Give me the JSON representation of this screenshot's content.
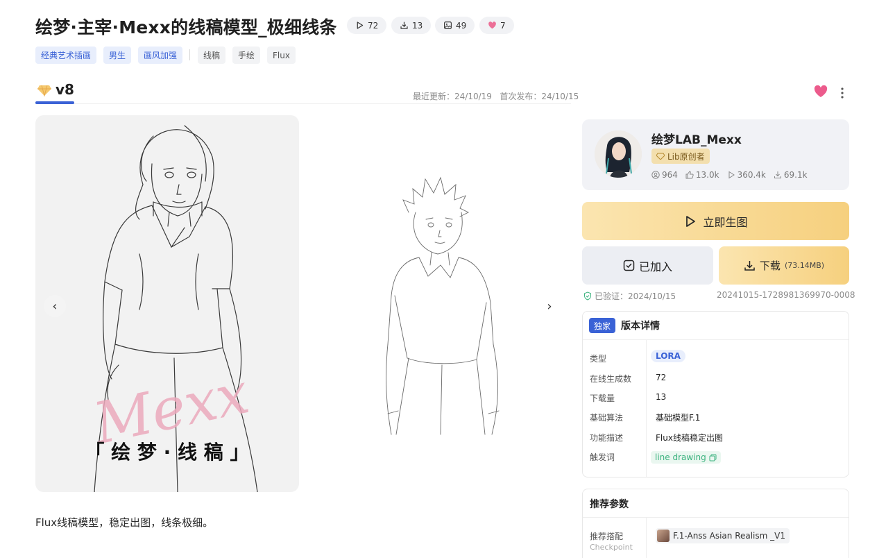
{
  "header": {
    "title": "绘梦·主宰·Mexx的线稿模型_极细线条",
    "stats": {
      "runs": "72",
      "downloads": "13",
      "images": "49",
      "likes": "7"
    },
    "tags_blue": [
      "经典艺术插画",
      "男生",
      "画风加强"
    ],
    "tags_gray": [
      "线稿",
      "手绘",
      "Flux"
    ]
  },
  "version": {
    "label": "v8",
    "last_update": "最近更新：24/10/19",
    "first_release": "首次发布：24/10/15"
  },
  "gallery": {
    "watermark": "Mexx",
    "caption": "「 绘 梦 · 线 稿 」"
  },
  "description": "Flux线稿模型，稳定出图，线条极细。",
  "author": {
    "name": "绘梦LAB_Mexx",
    "badge": "Lib原创者",
    "followers": "964",
    "likes": "13.0k",
    "runs": "360.4k",
    "downloads": "69.1k"
  },
  "actions": {
    "generate": "立即生图",
    "added": "已加入",
    "download": "下载",
    "download_size": "(73.14MB)"
  },
  "verify": {
    "text": "已验证：2024/10/15",
    "hash": "20241015-1728981369970-0008"
  },
  "details": {
    "exclusive": "独家",
    "title": "版本详情",
    "rows": [
      {
        "k": "类型",
        "v": "LORA"
      },
      {
        "k": "在线生成数",
        "v": "72"
      },
      {
        "k": "下载量",
        "v": "13"
      },
      {
        "k": "基础算法",
        "v": "基础模型F.1"
      },
      {
        "k": "功能描述",
        "v": "Flux线稿稳定出图"
      },
      {
        "k": "触发词",
        "v": "line drawing"
      }
    ]
  },
  "recommend": {
    "title": "推荐参数",
    "key": "推荐搭配",
    "sub": "Checkpoint",
    "checkpoint": "F.1-Anss Asian Realism _V1"
  },
  "colors": {
    "accent": "#3a62d6",
    "gold": "#f6d07e",
    "pink": "#e8588a"
  }
}
